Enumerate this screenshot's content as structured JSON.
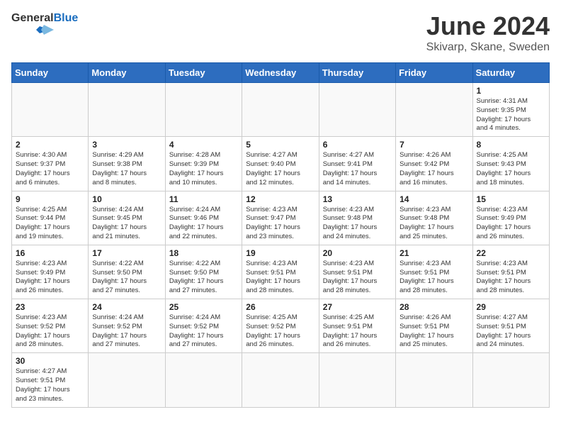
{
  "header": {
    "logo_general": "General",
    "logo_blue": "Blue",
    "month": "June 2024",
    "location": "Skivarp, Skane, Sweden"
  },
  "days_of_week": [
    "Sunday",
    "Monday",
    "Tuesday",
    "Wednesday",
    "Thursday",
    "Friday",
    "Saturday"
  ],
  "weeks": [
    [
      {
        "day": "",
        "info": ""
      },
      {
        "day": "",
        "info": ""
      },
      {
        "day": "",
        "info": ""
      },
      {
        "day": "",
        "info": ""
      },
      {
        "day": "",
        "info": ""
      },
      {
        "day": "",
        "info": ""
      },
      {
        "day": "1",
        "info": "Sunrise: 4:31 AM\nSunset: 9:35 PM\nDaylight: 17 hours\nand 4 minutes."
      }
    ],
    [
      {
        "day": "2",
        "info": "Sunrise: 4:30 AM\nSunset: 9:37 PM\nDaylight: 17 hours\nand 6 minutes."
      },
      {
        "day": "3",
        "info": "Sunrise: 4:29 AM\nSunset: 9:38 PM\nDaylight: 17 hours\nand 8 minutes."
      },
      {
        "day": "4",
        "info": "Sunrise: 4:28 AM\nSunset: 9:39 PM\nDaylight: 17 hours\nand 10 minutes."
      },
      {
        "day": "5",
        "info": "Sunrise: 4:27 AM\nSunset: 9:40 PM\nDaylight: 17 hours\nand 12 minutes."
      },
      {
        "day": "6",
        "info": "Sunrise: 4:27 AM\nSunset: 9:41 PM\nDaylight: 17 hours\nand 14 minutes."
      },
      {
        "day": "7",
        "info": "Sunrise: 4:26 AM\nSunset: 9:42 PM\nDaylight: 17 hours\nand 16 minutes."
      },
      {
        "day": "8",
        "info": "Sunrise: 4:25 AM\nSunset: 9:43 PM\nDaylight: 17 hours\nand 18 minutes."
      }
    ],
    [
      {
        "day": "9",
        "info": "Sunrise: 4:25 AM\nSunset: 9:44 PM\nDaylight: 17 hours\nand 19 minutes."
      },
      {
        "day": "10",
        "info": "Sunrise: 4:24 AM\nSunset: 9:45 PM\nDaylight: 17 hours\nand 21 minutes."
      },
      {
        "day": "11",
        "info": "Sunrise: 4:24 AM\nSunset: 9:46 PM\nDaylight: 17 hours\nand 22 minutes."
      },
      {
        "day": "12",
        "info": "Sunrise: 4:23 AM\nSunset: 9:47 PM\nDaylight: 17 hours\nand 23 minutes."
      },
      {
        "day": "13",
        "info": "Sunrise: 4:23 AM\nSunset: 9:48 PM\nDaylight: 17 hours\nand 24 minutes."
      },
      {
        "day": "14",
        "info": "Sunrise: 4:23 AM\nSunset: 9:48 PM\nDaylight: 17 hours\nand 25 minutes."
      },
      {
        "day": "15",
        "info": "Sunrise: 4:23 AM\nSunset: 9:49 PM\nDaylight: 17 hours\nand 26 minutes."
      }
    ],
    [
      {
        "day": "16",
        "info": "Sunrise: 4:23 AM\nSunset: 9:49 PM\nDaylight: 17 hours\nand 26 minutes."
      },
      {
        "day": "17",
        "info": "Sunrise: 4:22 AM\nSunset: 9:50 PM\nDaylight: 17 hours\nand 27 minutes."
      },
      {
        "day": "18",
        "info": "Sunrise: 4:22 AM\nSunset: 9:50 PM\nDaylight: 17 hours\nand 27 minutes."
      },
      {
        "day": "19",
        "info": "Sunrise: 4:23 AM\nSunset: 9:51 PM\nDaylight: 17 hours\nand 28 minutes."
      },
      {
        "day": "20",
        "info": "Sunrise: 4:23 AM\nSunset: 9:51 PM\nDaylight: 17 hours\nand 28 minutes."
      },
      {
        "day": "21",
        "info": "Sunrise: 4:23 AM\nSunset: 9:51 PM\nDaylight: 17 hours\nand 28 minutes."
      },
      {
        "day": "22",
        "info": "Sunrise: 4:23 AM\nSunset: 9:51 PM\nDaylight: 17 hours\nand 28 minutes."
      }
    ],
    [
      {
        "day": "23",
        "info": "Sunrise: 4:23 AM\nSunset: 9:52 PM\nDaylight: 17 hours\nand 28 minutes."
      },
      {
        "day": "24",
        "info": "Sunrise: 4:24 AM\nSunset: 9:52 PM\nDaylight: 17 hours\nand 27 minutes."
      },
      {
        "day": "25",
        "info": "Sunrise: 4:24 AM\nSunset: 9:52 PM\nDaylight: 17 hours\nand 27 minutes."
      },
      {
        "day": "26",
        "info": "Sunrise: 4:25 AM\nSunset: 9:52 PM\nDaylight: 17 hours\nand 26 minutes."
      },
      {
        "day": "27",
        "info": "Sunrise: 4:25 AM\nSunset: 9:51 PM\nDaylight: 17 hours\nand 26 minutes."
      },
      {
        "day": "28",
        "info": "Sunrise: 4:26 AM\nSunset: 9:51 PM\nDaylight: 17 hours\nand 25 minutes."
      },
      {
        "day": "29",
        "info": "Sunrise: 4:27 AM\nSunset: 9:51 PM\nDaylight: 17 hours\nand 24 minutes."
      }
    ],
    [
      {
        "day": "30",
        "info": "Sunrise: 4:27 AM\nSunset: 9:51 PM\nDaylight: 17 hours\nand 23 minutes."
      },
      {
        "day": "",
        "info": ""
      },
      {
        "day": "",
        "info": ""
      },
      {
        "day": "",
        "info": ""
      },
      {
        "day": "",
        "info": ""
      },
      {
        "day": "",
        "info": ""
      },
      {
        "day": "",
        "info": ""
      }
    ]
  ]
}
